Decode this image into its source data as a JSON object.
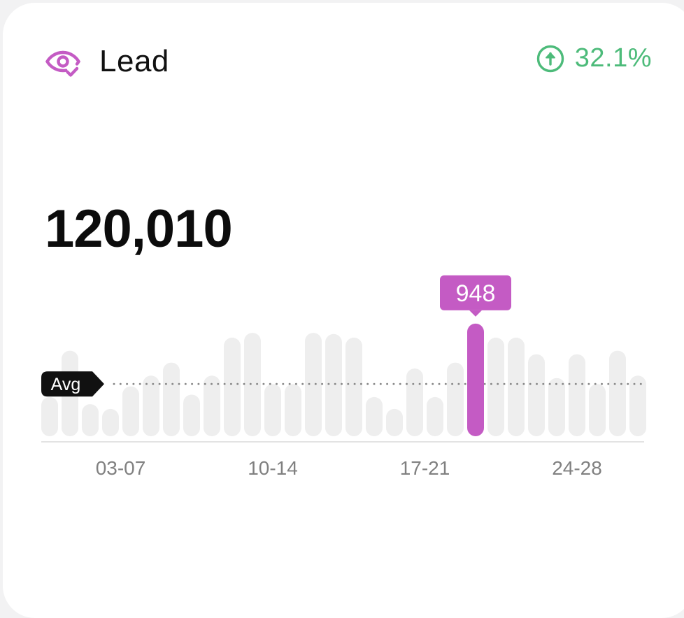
{
  "colors": {
    "accent": "#c45bc4",
    "positive": "#4dbb7a",
    "bar_inactive": "#eeeeee",
    "baseline": "#e3e3e3",
    "avg_line": "#8c8c8c",
    "tick_label": "#808080"
  },
  "card": {
    "title": "Lead",
    "title_icon": "eye-check-icon",
    "trend_icon": "arrow-up-circle-icon",
    "trend_text": "32.1%",
    "total_value": "120,010"
  },
  "chart_data": {
    "type": "bar",
    "title": "Lead",
    "bar_count": 30,
    "values": [
      330,
      720,
      270,
      230,
      420,
      510,
      620,
      350,
      510,
      830,
      870,
      440,
      440,
      870,
      860,
      830,
      330,
      230,
      570,
      330,
      620,
      948,
      830,
      830,
      690,
      490,
      690,
      440,
      720,
      510
    ],
    "highlighted_index": 21,
    "highlight_label": "948",
    "average": 440,
    "avg_label": "Avg",
    "y_max": 1000,
    "x_tick_labels": [
      {
        "label": "03-07",
        "center_index": 3.5
      },
      {
        "label": "10-14",
        "center_index": 11
      },
      {
        "label": "17-21",
        "center_index": 18.5
      },
      {
        "label": "24-28",
        "center_index": 26
      }
    ],
    "grid": false,
    "legend": "none"
  }
}
